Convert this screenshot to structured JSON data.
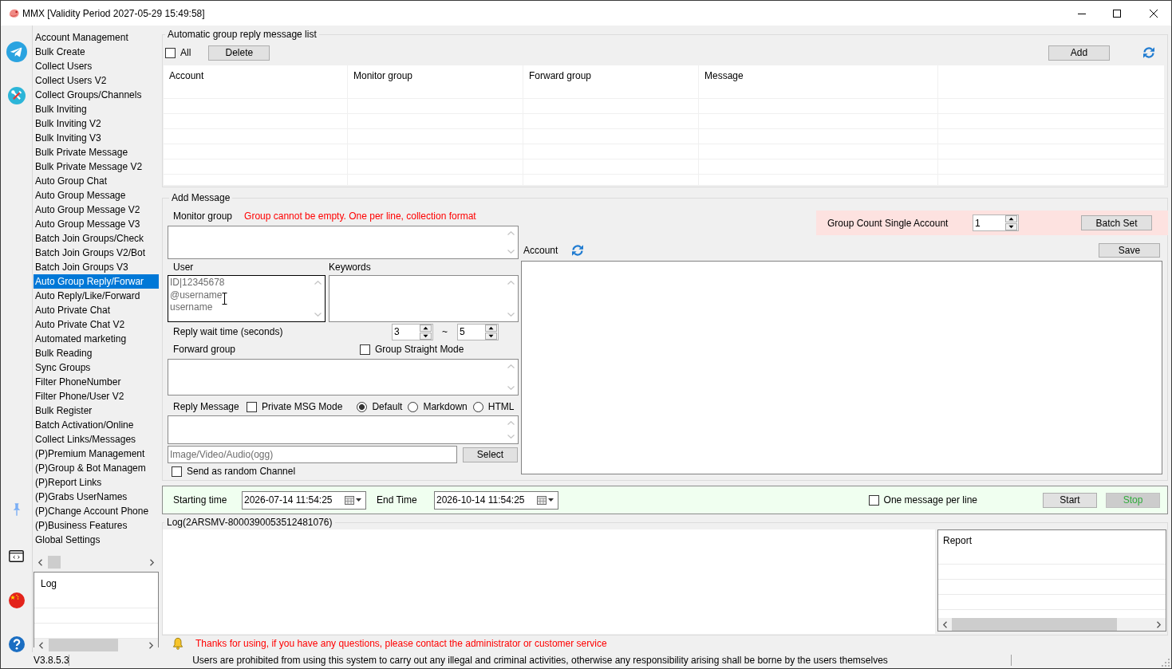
{
  "window": {
    "title": "MMX [Validity Period 2027-05-29 15:49:58]"
  },
  "sidebar": {
    "items": [
      {
        "label": "Account Management",
        "selected": false
      },
      {
        "label": "Bulk Create",
        "selected": false
      },
      {
        "label": "Collect Users",
        "selected": false
      },
      {
        "label": "Collect Users V2",
        "selected": false
      },
      {
        "label": "Collect Groups/Channels",
        "selected": false
      },
      {
        "label": "Bulk Inviting",
        "selected": false
      },
      {
        "label": "Bulk Inviting V2",
        "selected": false
      },
      {
        "label": "Bulk Inviting V3",
        "selected": false
      },
      {
        "label": "Bulk Private Message",
        "selected": false
      },
      {
        "label": "Bulk Private Message V2",
        "selected": false
      },
      {
        "label": "Auto Group Chat",
        "selected": false
      },
      {
        "label": "Auto Group Message",
        "selected": false
      },
      {
        "label": "Auto Group Message V2",
        "selected": false
      },
      {
        "label": "Auto Group Message V3",
        "selected": false
      },
      {
        "label": "Batch Join Groups/Check",
        "selected": false
      },
      {
        "label": "Batch Join Groups V2/Bot",
        "selected": false
      },
      {
        "label": "Batch Join Groups V3",
        "selected": false
      },
      {
        "label": "Auto Group Reply/Forwar",
        "selected": true
      },
      {
        "label": "Auto Reply/Like/Forward",
        "selected": false
      },
      {
        "label": "Auto Private Chat",
        "selected": false
      },
      {
        "label": "Auto Private Chat V2",
        "selected": false
      },
      {
        "label": "Automated marketing",
        "selected": false
      },
      {
        "label": "Bulk Reading",
        "selected": false
      },
      {
        "label": "Sync Groups",
        "selected": false
      },
      {
        "label": "Filter PhoneNumber",
        "selected": false
      },
      {
        "label": "Filter Phone/User V2",
        "selected": false
      },
      {
        "label": "Bulk Register",
        "selected": false
      },
      {
        "label": "Batch Activation/Online",
        "selected": false
      },
      {
        "label": "Collect Links/Messages",
        "selected": false
      },
      {
        "label": "(P)Premium Management",
        "selected": false
      },
      {
        "label": "(P)Group & Bot Managem",
        "selected": false
      },
      {
        "label": "(P)Report Links",
        "selected": false
      },
      {
        "label": "(P)Grabs UserNames",
        "selected": false
      },
      {
        "label": "(P)Change Account Phone",
        "selected": false
      },
      {
        "label": "(P)Business Features",
        "selected": false
      },
      {
        "label": "Global Settings",
        "selected": false
      }
    ],
    "log_panel": {
      "header": "Log"
    }
  },
  "reply_list": {
    "title": "Automatic group reply message list",
    "select_all": {
      "label": "All",
      "checked": false
    },
    "delete_button": "Delete",
    "add_button": "Add",
    "columns": [
      "Account",
      "Monitor group",
      "Forward group",
      "Message"
    ]
  },
  "add_message": {
    "title": "Add Message",
    "monitor_group": {
      "label": "Monitor group",
      "hint": "Group cannot be empty. One per line, collection format"
    },
    "user": {
      "label": "User",
      "placeholder": "ID|12345678\n@username\nusername",
      "focused": true
    },
    "keywords": {
      "label": "Keywords"
    },
    "reply_wait": {
      "label": "Reply wait time (seconds)",
      "min": "3",
      "separator": "~",
      "max": "5"
    },
    "forward_group": {
      "label": "Forward group"
    },
    "group_straight_mode": {
      "label": "Group Straight Mode",
      "checked": false
    },
    "reply_message": {
      "label": "Reply Message"
    },
    "private_msg_mode": {
      "label": "Private MSG Mode",
      "checked": false
    },
    "format_options": [
      {
        "label": "Default",
        "selected": true
      },
      {
        "label": "Markdown",
        "selected": false
      },
      {
        "label": "HTML",
        "selected": false
      }
    ],
    "media": {
      "placeholder": "Image/Video/Audio(ogg)",
      "button": "Select"
    },
    "random_channel": {
      "label": "Send as random Channel",
      "checked": false
    },
    "group_count": {
      "label": "Group Count Single Account",
      "value": "1",
      "button": "Batch Set"
    },
    "account": {
      "label": "Account",
      "button": "Save"
    }
  },
  "schedule": {
    "start_label": "Starting time",
    "start_value": "2026-07-14 11:54:25",
    "end_label": "End Time",
    "end_value": "2026-10-14 11:54:25",
    "one_per_line": {
      "label": "One message per line",
      "checked": false
    },
    "buttons": [
      {
        "label": "Start",
        "kind": "normal"
      },
      {
        "label": "Stop",
        "kind": "stop"
      }
    ]
  },
  "log": {
    "title": "Log(2ARSMV-8000390053512481076)",
    "report_header": "Report"
  },
  "notice": "Thanks for using, if you have any questions, please contact the administrator or customer service",
  "status_bar": {
    "version": "V3.8.5.3",
    "message": "Users are prohibited from using this system to carry out any illegal and criminal activities, otherwise any responsibility arising shall be borne by the users themselves"
  }
}
